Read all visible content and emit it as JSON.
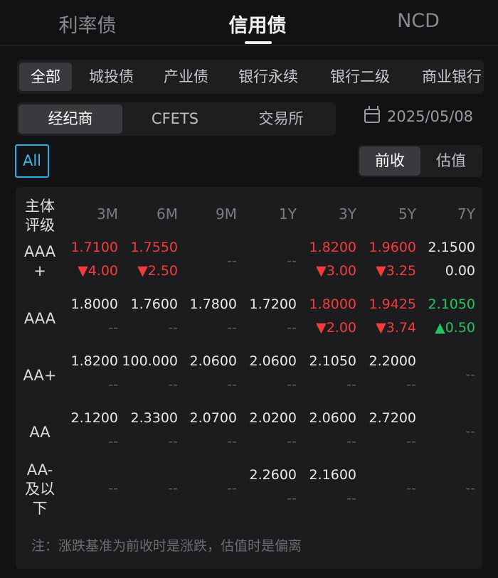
{
  "top_tabs": [
    "利率债",
    "信用债",
    "NCD"
  ],
  "categories": [
    "全部",
    "城投债",
    "产业债",
    "银行永续",
    "银行二级",
    "商业银行"
  ],
  "sources": [
    "经纪商",
    "CFETS",
    "交易所"
  ],
  "date": "2025/05/08",
  "all_label": "All",
  "price_options": [
    "前收",
    "估值"
  ],
  "table": {
    "corner_label": [
      "主体",
      "评级"
    ],
    "columns": [
      "3M",
      "6M",
      "9M",
      "1Y",
      "3Y",
      "5Y",
      "7Y"
    ],
    "rows": [
      {
        "label": [
          "AAA",
          "+"
        ],
        "cells": [
          {
            "v": "1.7100",
            "c": "▼4.00",
            "col": "red"
          },
          {
            "v": "1.7550",
            "c": "▼2.50",
            "col": "red"
          },
          {
            "v": "--",
            "c": "",
            "col": "dash"
          },
          {
            "v": "--",
            "c": "",
            "col": "dash"
          },
          {
            "v": "1.8200",
            "c": "▼3.00",
            "col": "red"
          },
          {
            "v": "1.9600",
            "c": "▼3.25",
            "col": "red"
          },
          {
            "v": "2.1500",
            "c": "0.00",
            "col": "white"
          }
        ]
      },
      {
        "label": [
          "AAA"
        ],
        "cells": [
          {
            "v": "1.8000",
            "c": "--",
            "col": "white"
          },
          {
            "v": "1.7600",
            "c": "--",
            "col": "white"
          },
          {
            "v": "1.7800",
            "c": "--",
            "col": "white"
          },
          {
            "v": "1.7200",
            "c": "--",
            "col": "white"
          },
          {
            "v": "1.8000",
            "c": "▼2.00",
            "col": "red"
          },
          {
            "v": "1.9425",
            "c": "▼3.74",
            "col": "red"
          },
          {
            "v": "2.1050",
            "c": "▲0.50",
            "col": "green"
          }
        ]
      },
      {
        "label": [
          "AA+"
        ],
        "cells": [
          {
            "v": "1.8200",
            "c": "--",
            "col": "white"
          },
          {
            "v": "100.000",
            "c": "--",
            "col": "white"
          },
          {
            "v": "2.0600",
            "c": "--",
            "col": "white"
          },
          {
            "v": "2.0600",
            "c": "--",
            "col": "white"
          },
          {
            "v": "2.1050",
            "c": "--",
            "col": "white"
          },
          {
            "v": "2.2000",
            "c": "--",
            "col": "white"
          },
          {
            "v": "--",
            "c": "",
            "col": "dash"
          }
        ]
      },
      {
        "label": [
          "AA"
        ],
        "cells": [
          {
            "v": "2.1200",
            "c": "--",
            "col": "white"
          },
          {
            "v": "2.3300",
            "c": "--",
            "col": "white"
          },
          {
            "v": "2.0700",
            "c": "--",
            "col": "white"
          },
          {
            "v": "2.0200",
            "c": "--",
            "col": "white"
          },
          {
            "v": "2.0600",
            "c": "--",
            "col": "white"
          },
          {
            "v": "2.7200",
            "c": "--",
            "col": "white"
          },
          {
            "v": "--",
            "c": "",
            "col": "dash"
          }
        ]
      },
      {
        "label": [
          "AA-",
          "及以",
          "下"
        ],
        "cells": [
          {
            "v": "--",
            "c": "",
            "col": "dash"
          },
          {
            "v": "--",
            "c": "",
            "col": "dash"
          },
          {
            "v": "--",
            "c": "",
            "col": "dash"
          },
          {
            "v": "2.2600",
            "c": "--",
            "col": "white"
          },
          {
            "v": "2.1600",
            "c": "--",
            "col": "white"
          },
          {
            "v": "--",
            "c": "",
            "col": "dash"
          },
          {
            "v": "--",
            "c": "",
            "col": "dash"
          }
        ]
      }
    ]
  },
  "note": "注：涨跌基准为前收时是涨跌，估值时是偏离",
  "colors": {
    "accent": "#28aee0",
    "up": "#22c55e",
    "down": "#f23c3c"
  }
}
